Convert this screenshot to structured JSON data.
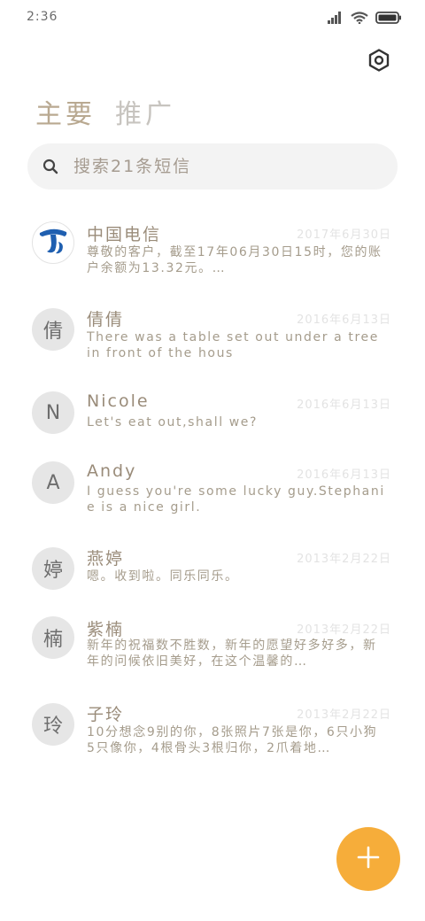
{
  "status_bar": {
    "time": "2:36",
    "icons": [
      "signal-icon",
      "wifi-icon",
      "battery-icon"
    ]
  },
  "header": {
    "settings_icon": "gear-icon"
  },
  "tabs": [
    {
      "label": "主要",
      "active": true
    },
    {
      "label": "推广",
      "active": false
    }
  ],
  "search": {
    "placeholder": "搜索21条短信"
  },
  "colors": {
    "accent": "#f6ad3a",
    "tab_active": "#b9a991",
    "tab_inactive": "#c7c4bf",
    "avatar_bg": "#e6e6e6",
    "search_bg": "#f3f3f3"
  },
  "messages": [
    {
      "avatar": "",
      "avatar_type": "logo",
      "sender": "中国电信",
      "date": "2017年6月30日",
      "preview": "尊敬的客户，截至17年06月30日15时，您的账户余额为13.32元。…"
    },
    {
      "avatar": "倩",
      "avatar_type": "letter",
      "sender": "倩倩",
      "date": "2016年6月13日",
      "preview": "There was a table set out under a tree in front of the hous"
    },
    {
      "avatar": "N",
      "avatar_type": "letter",
      "sender": "Nicole",
      "date": "2016年6月13日",
      "preview": "Let's eat out,shall we?"
    },
    {
      "avatar": "A",
      "avatar_type": "letter",
      "sender": "Andy",
      "date": "2016年6月13日",
      "preview": "I guess you're some lucky guy.Stephanie is a nice girl."
    },
    {
      "avatar": "婷",
      "avatar_type": "letter",
      "sender": "燕婷",
      "date": "2013年2月22日",
      "preview": "嗯。收到啦。同乐同乐。"
    },
    {
      "avatar": "楠",
      "avatar_type": "letter",
      "sender": "紫楠",
      "date": "2013年2月22日",
      "preview": "新年的祝福数不胜数，新年的愿望好多好多，新年的问候依旧美好，在这个温馨的…"
    },
    {
      "avatar": "玲",
      "avatar_type": "letter",
      "sender": "子玲",
      "date": "2013年2月22日",
      "preview": "10分想念9别的你，8张照片7张是你，6只小狗5只像你，4根骨头3根归你，2爪着地…"
    }
  ],
  "fab": {
    "icon": "plus-icon"
  }
}
